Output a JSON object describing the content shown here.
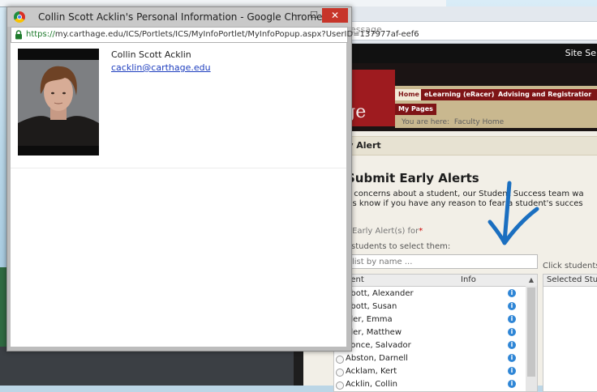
{
  "popup": {
    "window_title": "Collin Scott Acklin's Personal Information - Google Chrome",
    "url_scheme": "https://",
    "url_rest": "my.carthage.edu/ICS/Portlets/ICS/MyInfoPortlet/MyInfoPopup.aspx?UserID=137977af-eef6",
    "minimize_glyph": "–",
    "maximize_glyph": "☐",
    "close_glyph": "✕",
    "profile": {
      "name": "Collin Scott Acklin",
      "email": "cacklin@carthage.edu"
    }
  },
  "background_page": {
    "address_text": "essage",
    "site_search_label": "Site Se",
    "logo_text": "age",
    "nav": {
      "home": "Home",
      "elearning": "eLearning (eRacer)",
      "advising": "Advising and Registration",
      "mypages": "My Pages"
    },
    "breadcrumb_prefix": "You are here:",
    "breadcrumb_page": "Faculty Home",
    "portlet_title": "rly Alert",
    "section_title": "Submit Early Alerts",
    "intro_line1": "ve concerns about a student, our Student Success team wa",
    "intro_line2": "t us know if you have any reason to fear a student's succes",
    "alerts_for_label": "t Early Alert(s) for",
    "alerts_for_required": "*",
    "students_hint": "students to select them:",
    "filter_placeholder": "list by name ...",
    "click_hint": "Click students",
    "table": {
      "col_student": "dent",
      "col_info": "Info",
      "rows": [
        "bbott, Alexander",
        "bbott, Susan",
        "bler, Emma",
        "bler, Matthew",
        "bonce, Salvador",
        "Abston, Darnell",
        "Acklam, Kert",
        "Acklin, Collin"
      ],
      "info_glyph": "i"
    },
    "selected_header": "Selected Stu"
  },
  "colors": {
    "brand_red": "#9e1b1f",
    "close_button": "#c7352a",
    "link_blue": "#1f3fbf",
    "info_blue": "#2f86d6",
    "arrow_blue": "#1b6fc0"
  },
  "icons": [
    "chrome-logo-icon",
    "lock-icon",
    "info-icon",
    "radio-icon",
    "annotation-arrow-icon"
  ]
}
